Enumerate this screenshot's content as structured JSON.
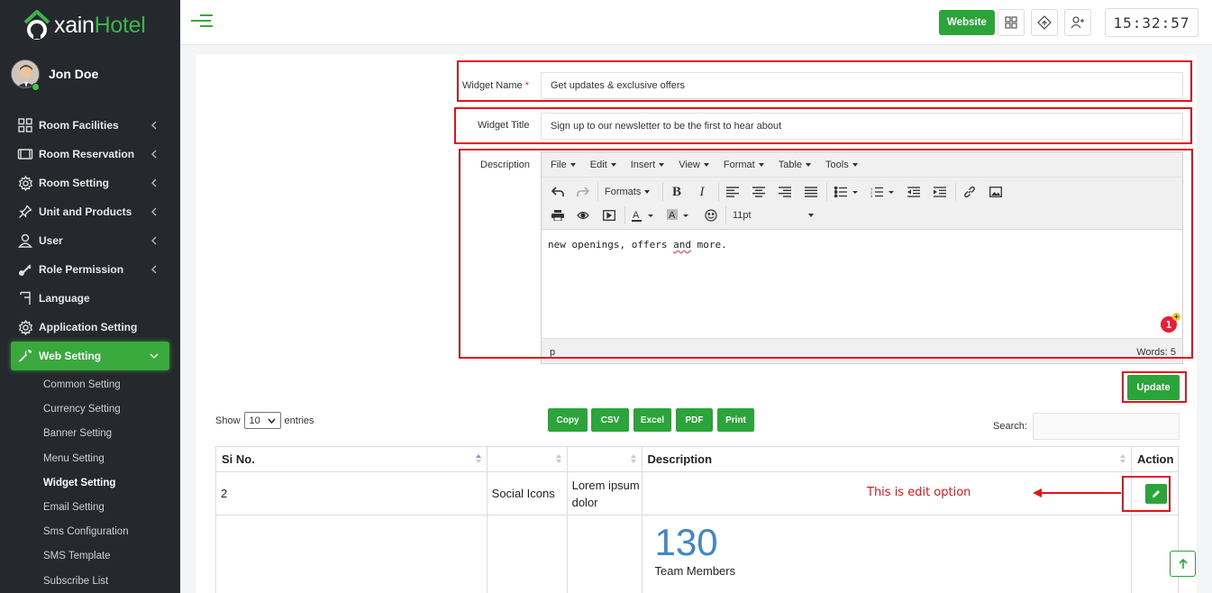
{
  "brand": {
    "logo_prefix": "xain",
    "logo_suffix": "Hotel",
    "accent": "#2ba539"
  },
  "user": {
    "name": "Jon Doe",
    "status": "online"
  },
  "sidebar": {
    "items": [
      {
        "label": "Room Facilities",
        "icon": "grid-icon",
        "has_children": true
      },
      {
        "label": "Room Reservation",
        "icon": "bed-icon",
        "has_children": true
      },
      {
        "label": "Room Setting",
        "icon": "gear-icon",
        "has_children": true
      },
      {
        "label": "Unit and Products",
        "icon": "pin-icon",
        "has_children": true
      },
      {
        "label": "User",
        "icon": "user-icon",
        "has_children": true
      },
      {
        "label": "Role Permission",
        "icon": "key-icon",
        "has_children": true
      },
      {
        "label": "Language",
        "icon": "flag-icon",
        "has_children": false
      },
      {
        "label": "Application Setting",
        "icon": "gear-icon",
        "has_children": false
      },
      {
        "label": "Web Setting",
        "icon": "wrench-icon",
        "has_children": true,
        "active": true
      }
    ],
    "submenu": [
      {
        "label": "Common Setting"
      },
      {
        "label": "Currency Setting"
      },
      {
        "label": "Banner Setting"
      },
      {
        "label": "Menu Setting"
      },
      {
        "label": "Widget Setting",
        "current": true
      },
      {
        "label": "Email Setting"
      },
      {
        "label": "Sms Configuration"
      },
      {
        "label": "SMS Template"
      },
      {
        "label": "Subscribe List"
      }
    ]
  },
  "topbar": {
    "website_label": "Website",
    "icons": [
      "apps-icon",
      "diamond-icon",
      "add-user-icon"
    ],
    "clock": "15:32:57"
  },
  "form": {
    "widget_name_label": "Widget Name",
    "widget_name_required": "*",
    "widget_name_value": "Get updates & exclusive offers",
    "widget_title_label": "Widget Title",
    "widget_title_value": "Sign up to our newsletter to be the first to hear about",
    "description_label": "Description",
    "update_label": "Update"
  },
  "editor": {
    "menus": [
      "File",
      "Edit",
      "Insert",
      "View",
      "Format",
      "Table",
      "Tools"
    ],
    "formats_label": "Formats",
    "font_size": "11pt",
    "content_before": "new openings, offers ",
    "content_misspelled": "and",
    "content_after": " more.",
    "notification_count": "1",
    "status_path": "p",
    "word_count": "Words: 5"
  },
  "datatable": {
    "show_label": "Show",
    "entries_value": "10",
    "entries_label": "entries",
    "buttons": [
      "Copy",
      "CSV",
      "Excel",
      "PDF",
      "Print"
    ],
    "search_label": "Search:",
    "columns": [
      "Si No.",
      "",
      "",
      "Description",
      "Action"
    ],
    "rows": [
      {
        "si": "2",
        "name": "Social Icons",
        "title": "Lorem ipsum dolor",
        "description": ""
      },
      {
        "si": "",
        "name": "",
        "title": "",
        "stat_number": "130",
        "stat_label": "Team Members"
      }
    ]
  },
  "annotation": {
    "text": "This is edit option",
    "color": "#e8121b"
  }
}
